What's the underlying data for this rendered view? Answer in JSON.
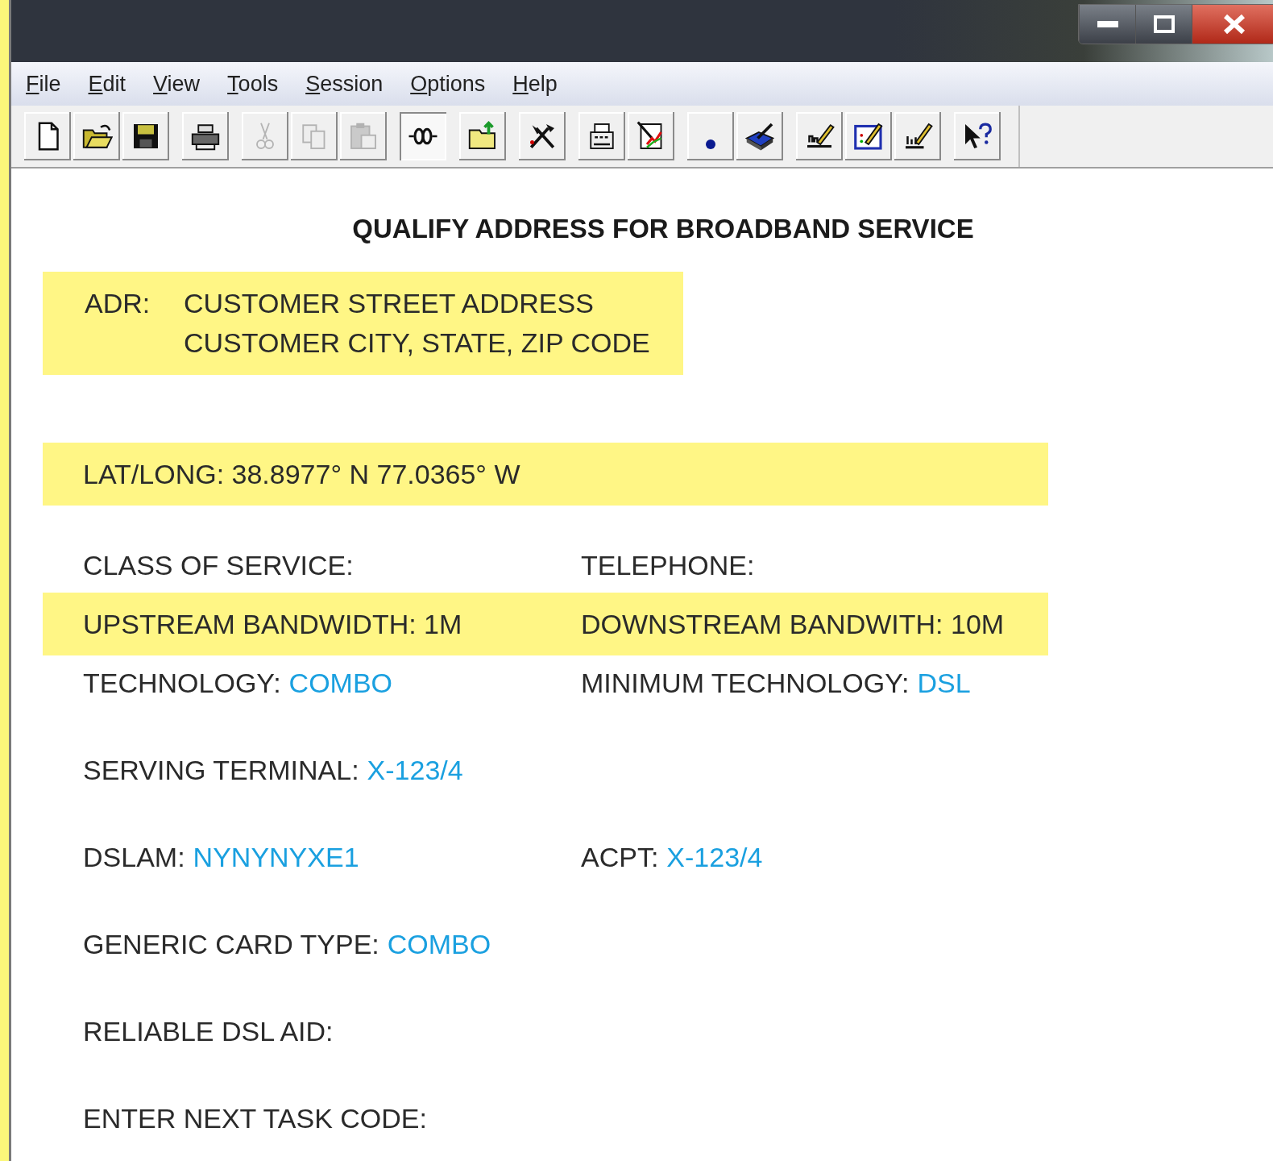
{
  "menu": [
    {
      "label": "File"
    },
    {
      "label": "Edit"
    },
    {
      "label": "View"
    },
    {
      "label": "Tools"
    },
    {
      "label": "Session"
    },
    {
      "label": "Options"
    },
    {
      "label": "Help"
    }
  ],
  "toolbar": [
    [
      {
        "disabled": false,
        "pressed": false
      },
      {
        "disabled": false,
        "pressed": false
      },
      {
        "disabled": false,
        "pressed": false
      }
    ],
    [
      {
        "disabled": false,
        "pressed": false
      }
    ],
    [
      {
        "disabled": true,
        "pressed": false
      },
      {
        "disabled": true,
        "pressed": false
      },
      {
        "disabled": true,
        "pressed": false
      }
    ],
    [
      {
        "disabled": false,
        "pressed": true
      }
    ],
    [
      {
        "disabled": false,
        "pressed": false
      }
    ],
    [
      {
        "disabled": false,
        "pressed": false
      }
    ],
    [
      {
        "disabled": false,
        "pressed": false
      },
      {
        "disabled": false,
        "pressed": false
      }
    ],
    [
      {
        "disabled": false,
        "pressed": false
      },
      {
        "disabled": false,
        "pressed": false
      }
    ],
    [
      {
        "disabled": false,
        "pressed": false
      },
      {
        "disabled": false,
        "pressed": false
      },
      {
        "disabled": false,
        "pressed": false
      }
    ],
    [
      {
        "disabled": false,
        "pressed": false
      }
    ]
  ],
  "heading": "QUALIFY ADDRESS FOR BROADBAND SERVICE",
  "address": {
    "label": "ADR:",
    "lines": [
      "CUSTOMER STREET ADDRESS",
      "CUSTOMER CITY, STATE, ZIP CODE"
    ],
    "highlighted": true
  },
  "groups": [
    {
      "rows": [
        {
          "highlighted": true,
          "fields": [
            {
              "label": "LAT/LONG:  38.8977° N 77.0365° W"
            }
          ]
        }
      ]
    },
    {
      "rows": [
        {
          "highlighted": false,
          "fields": [
            {
              "label": "CLASS OF SERVICE:"
            },
            {
              "label": "TELEPHONE:"
            }
          ]
        },
        {
          "highlighted": true,
          "fields": [
            {
              "label": "UPSTREAM BANDWIDTH: 1M"
            },
            {
              "label": "DOWNSTREAM BANDWITH: 10M"
            }
          ]
        },
        {
          "highlighted": false,
          "fields": [
            {
              "label": "TECHNOLOGY:",
              "value": "COMBO"
            },
            {
              "label": "MINIMUM TECHNOLOGY:",
              "value": "DSL"
            }
          ]
        }
      ]
    },
    {
      "rows": [
        {
          "highlighted": false,
          "fields": [
            {
              "label": "SERVING TERMINAL:",
              "value": "X-123/4"
            }
          ]
        }
      ]
    },
    {
      "rows": [
        {
          "highlighted": false,
          "fields": [
            {
              "label": "DSLAM:",
              "value": "NYNYNYXE1"
            },
            {
              "label": "ACPT:",
              "value": "X-123/4"
            }
          ]
        }
      ]
    },
    {
      "rows": [
        {
          "highlighted": false,
          "fields": [
            {
              "label": "GENERIC CARD TYPE:",
              "value": "COMBO"
            }
          ]
        }
      ]
    },
    {
      "rows": [
        {
          "highlighted": false,
          "fields": [
            {
              "label": "RELIABLE DSL AID:"
            }
          ]
        }
      ]
    },
    {
      "rows": [
        {
          "highlighted": false,
          "fields": [
            {
              "label": "ENTER NEXT TASK CODE:"
            }
          ]
        }
      ]
    }
  ]
}
